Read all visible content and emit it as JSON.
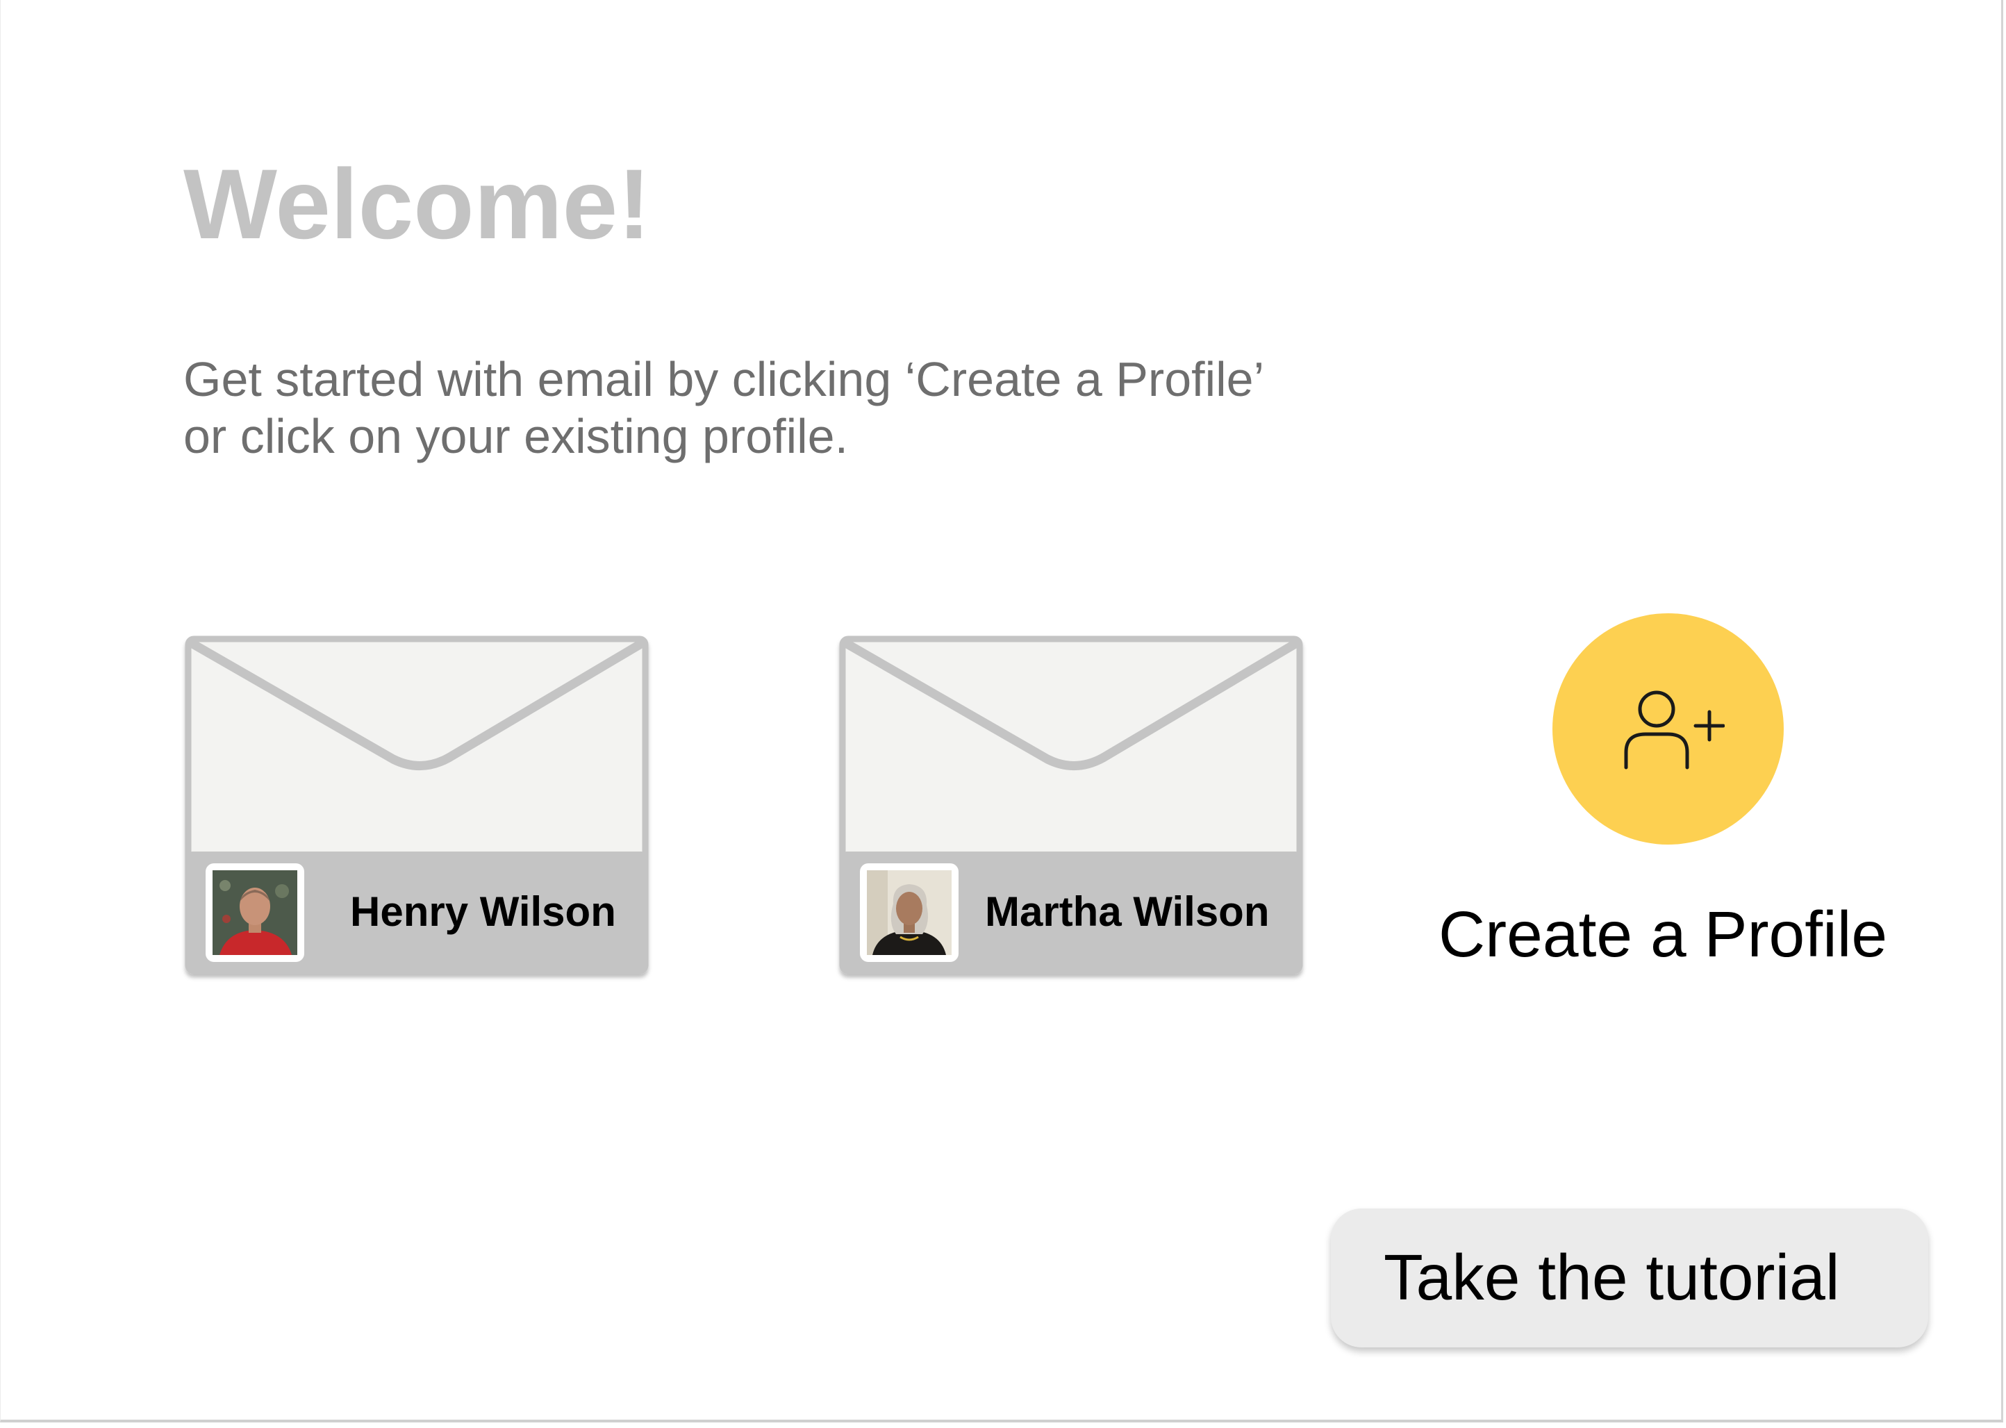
{
  "welcome": {
    "title": "Welcome!",
    "instructions_line1": "Get started with email by clicking ‘Create a Profile’",
    "instructions_line2": "or click on your existing profile."
  },
  "profiles": [
    {
      "name": "Henry Wilson",
      "avatar_icon": "henry-avatar-photo"
    },
    {
      "name": "Martha Wilson",
      "avatar_icon": "martha-avatar-photo"
    }
  ],
  "create_profile": {
    "label": "Create a Profile",
    "icon": "add-user-icon"
  },
  "tutorial": {
    "label": "Take the tutorial"
  },
  "colors": {
    "title": "#c3c3c3",
    "instructions": "#6e6e6e",
    "envelope_fill": "#f3f3f1",
    "envelope_stroke": "#c4c4c4",
    "name_bar": "#c4c4c4",
    "create_accent": "#fdd051",
    "tutorial_button": "#ebebeb"
  }
}
